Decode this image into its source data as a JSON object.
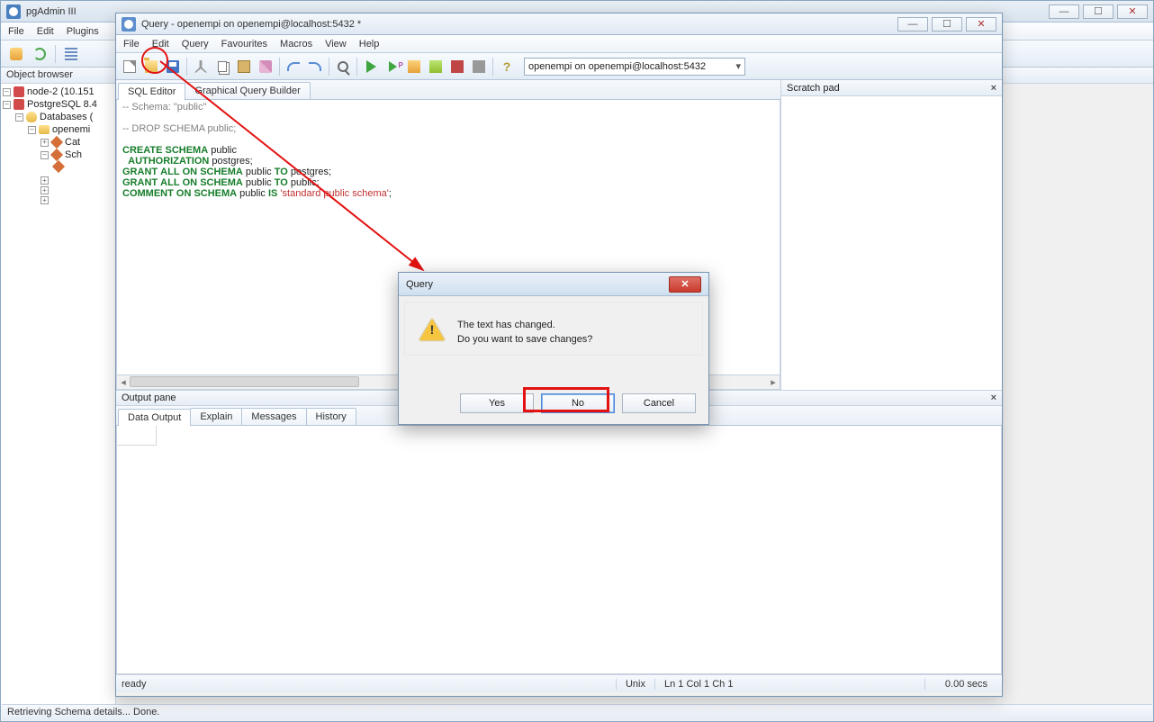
{
  "outer": {
    "title": "pgAdmin III",
    "menus": [
      "File",
      "Edit",
      "Plugins"
    ],
    "object_browser_title": "Object browser",
    "statusbar": "Retrieving Schema details... Done.",
    "tree": [
      {
        "indent": 0,
        "exp": "–",
        "icon": "srv",
        "label": "node-2 (10.151"
      },
      {
        "indent": 0,
        "exp": "–",
        "icon": "srv",
        "label": "PostgreSQL 8.4"
      },
      {
        "indent": 1,
        "exp": "–",
        "icon": "cyl",
        "label": "Databases ("
      },
      {
        "indent": 2,
        "exp": "–",
        "icon": "dbico",
        "label": "openemi"
      },
      {
        "indent": 3,
        "exp": "+",
        "icon": "diamond",
        "label": "Cat"
      },
      {
        "indent": 3,
        "exp": "–",
        "icon": "diamond",
        "label": "Sch"
      },
      {
        "indent": 4,
        "exp": "",
        "icon": "diamond",
        "label": ""
      },
      {
        "indent": 4,
        "exp": "",
        "icon": "",
        "label": ""
      },
      {
        "indent": 4,
        "exp": "",
        "icon": "",
        "label": ""
      },
      {
        "indent": 3,
        "exp": "+",
        "icon": "",
        "label": ""
      },
      {
        "indent": 3,
        "exp": "+",
        "icon": "",
        "label": ""
      },
      {
        "indent": 3,
        "exp": "+",
        "icon": "",
        "label": ""
      }
    ]
  },
  "query": {
    "title": "Query - openempi on openempi@localhost:5432 *",
    "menus": [
      "File",
      "Edit",
      "Query",
      "Favourites",
      "Macros",
      "View",
      "Help"
    ],
    "connection": "openempi on openempi@localhost:5432",
    "tabs": {
      "sql": "SQL Editor",
      "gqb": "Graphical Query Builder"
    },
    "sql_lines": [
      {
        "t": "cmt",
        "v": "-- Schema: \"public\""
      },
      {
        "t": "blank",
        "v": ""
      },
      {
        "t": "cmt",
        "v": "-- DROP SCHEMA public;"
      },
      {
        "t": "blank",
        "v": ""
      },
      {
        "t": "stmt",
        "v": "CREATE SCHEMA public"
      },
      {
        "t": "stmt",
        "v": "  AUTHORIZATION postgres;"
      },
      {
        "t": "stmt",
        "v": "GRANT ALL ON SCHEMA public TO postgres;"
      },
      {
        "t": "stmt",
        "v": "GRANT ALL ON SCHEMA public TO public;"
      },
      {
        "t": "stmt_str",
        "pre": "COMMENT ON SCHEMA public IS ",
        "str": "'standard public schema'",
        "post": ";"
      }
    ],
    "scratch_title": "Scratch pad",
    "output_title": "Output pane",
    "output_tabs": [
      "Data Output",
      "Explain",
      "Messages",
      "History"
    ],
    "status": {
      "ready": "ready",
      "os": "Unix",
      "pos": "Ln 1 Col 1 Ch 1",
      "time": "0.00 secs"
    }
  },
  "dialog": {
    "title": "Query",
    "line1": "The text has changed.",
    "line2": "Do you want to save changes?",
    "yes": "Yes",
    "no": "No",
    "cancel": "Cancel"
  }
}
